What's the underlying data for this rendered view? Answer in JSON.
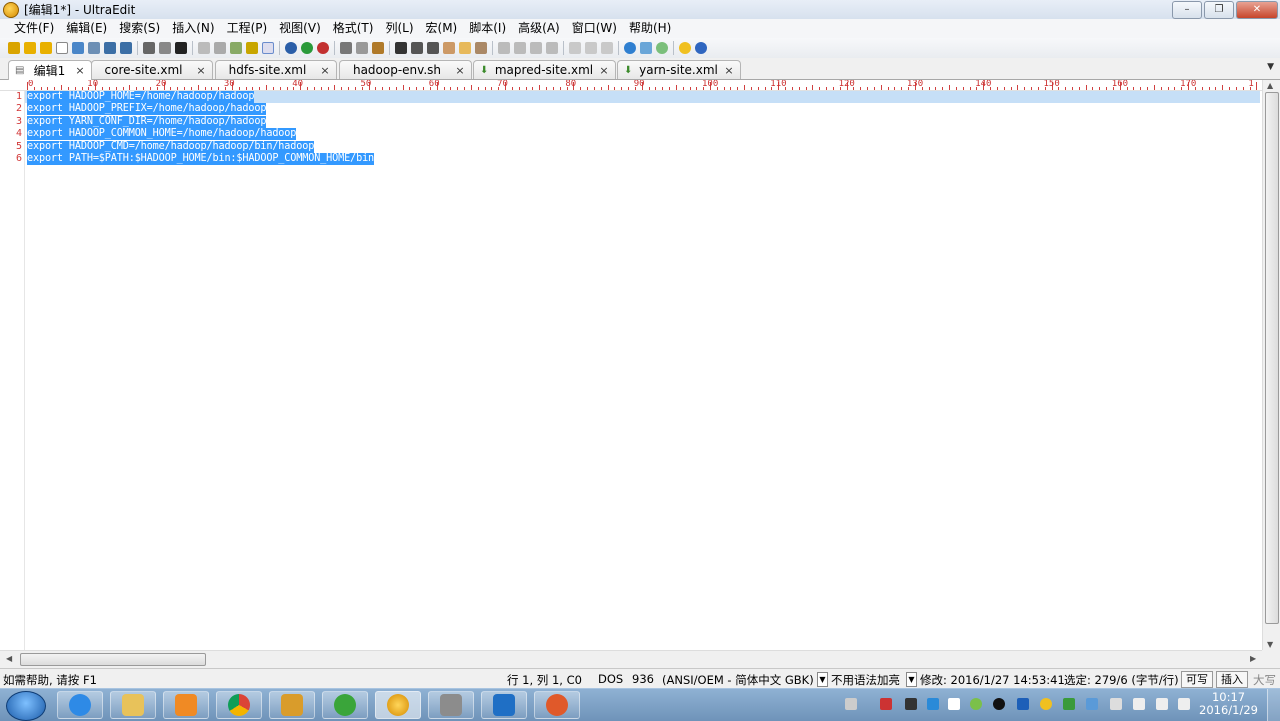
{
  "window": {
    "title": "[编辑1*] - UltraEdit",
    "controls": [
      "–",
      "❐",
      "✕"
    ]
  },
  "menu": [
    "文件(F)",
    "编辑(E)",
    "搜索(S)",
    "插入(N)",
    "工程(P)",
    "视图(V)",
    "格式(T)",
    "列(L)",
    "宏(M)",
    "脚本(I)",
    "高级(A)",
    "窗口(W)",
    "帮助(H)"
  ],
  "tabs": [
    {
      "label": "编辑1",
      "active": true,
      "icon": "document-icon"
    },
    {
      "label": "core-site.xml",
      "active": false,
      "icon": ""
    },
    {
      "label": "hdfs-site.xml",
      "active": false,
      "icon": ""
    },
    {
      "label": "hadoop-env.sh",
      "active": false,
      "icon": ""
    },
    {
      "label": "mapred-site.xml",
      "active": false,
      "icon": "download-arrow-icon"
    },
    {
      "label": "yarn-site.xml",
      "active": false,
      "icon": "download-arrow-icon"
    }
  ],
  "tab_close_glyph": "×",
  "ruler": {
    "labels": [
      "0",
      "10",
      "20",
      "30",
      "40",
      "50",
      "60",
      "70",
      "80",
      "90",
      "100",
      "110",
      "120",
      "130",
      "140",
      "150",
      "160",
      "170",
      "1"
    ]
  },
  "editor": {
    "line_numbers": [
      "1",
      "2",
      "3",
      "4",
      "5",
      "6"
    ],
    "lines": [
      "export HADOOP_HOME=/home/hadoop/hadoop",
      "export HADOOP_PREFIX=/home/hadoop/hadoop",
      "export YARN_CONF_DIR=/home/hadoop/hadoop",
      "export HADOOP_COMMON_HOME=/home/hadoop/hadoop",
      "export HADOOP_CMD=/home/hadoop/hadoop/bin/hadoop",
      "export PATH=$PATH:$HADOOP_HOME/bin:$HADOOP_COMMON_HOME/bin"
    ],
    "selection_color": "#3399ff",
    "caret_line_color": "#c6dff7",
    "line_number_color": "#d23838"
  },
  "statusbar": {
    "help": "如需帮助, 请按 F1",
    "position": "行 1, 列 1, C0",
    "line_ending": "DOS",
    "codepage": "936",
    "encoding": "(ANSI/OEM - 简体中文 GBK)",
    "highlighting": "不用语法加亮",
    "modified": "修改: 2016/1/27 14:53:41",
    "selection": "选定: 279/6 (字节/行)",
    "mode_rw": "可写",
    "mode_insert": "插入",
    "caps": "大写"
  },
  "taskbar": {
    "apps": [
      "internet-explorer-icon",
      "file-explorer-icon",
      "media-player-icon",
      "chrome-icon",
      "network-share-icon",
      "refresh-browser-icon",
      "ultraedit-icon",
      "scanner-icon",
      "virtualbox-icon",
      "game-icon"
    ],
    "time": "10:17",
    "date": "2016/1/29"
  },
  "colors": {
    "accent": "#3399ff",
    "taskbar": "#7a9cc2"
  }
}
